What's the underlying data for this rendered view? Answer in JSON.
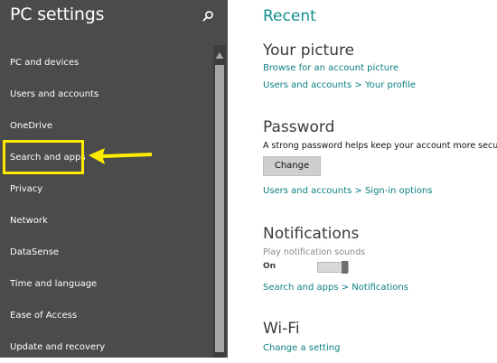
{
  "sidebar": {
    "title": "PC settings",
    "items": [
      {
        "label": "PC and devices"
      },
      {
        "label": "Users and accounts"
      },
      {
        "label": "OneDrive"
      },
      {
        "label": "Search and apps"
      },
      {
        "label": "Privacy"
      },
      {
        "label": "Network"
      },
      {
        "label": "DataSense"
      },
      {
        "label": "Time and language"
      },
      {
        "label": "Ease of Access"
      },
      {
        "label": "Update and recovery"
      }
    ]
  },
  "main": {
    "title": "Recent",
    "your_picture": {
      "heading": "Your picture",
      "link1": "Browse for an account picture",
      "link2": "Users and accounts > Your profile"
    },
    "password": {
      "heading": "Password",
      "description": "A strong password helps keep your account more secure",
      "button": "Change",
      "link": "Users and accounts > Sign-in options"
    },
    "notifications": {
      "heading": "Notifications",
      "setting_label": "Play notification sounds",
      "state": "On",
      "link": "Search and apps > Notifications"
    },
    "wifi": {
      "heading": "Wi-Fi",
      "link": "Change a setting"
    }
  },
  "colors": {
    "sidebar_bg": "#4b4b4b",
    "accent": "#138f8f",
    "highlight": "#ffeb00"
  },
  "icons": {
    "search": "search-icon",
    "scroll_up": "chevron-up-icon",
    "annotation": "arrow-left-icon"
  }
}
